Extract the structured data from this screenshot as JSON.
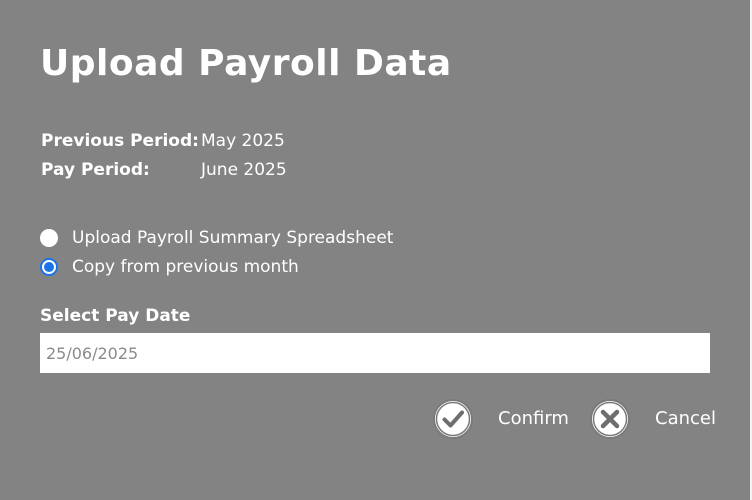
{
  "dialog": {
    "title": "Upload Payroll Data",
    "info": {
      "previous_period_label": "Previous Period:",
      "previous_period_value": "May 2025",
      "pay_period_label": "Pay Period:",
      "pay_period_value": "June 2025"
    },
    "options": [
      {
        "label": "Upload Payroll Summary Spreadsheet",
        "selected": false
      },
      {
        "label": "Copy from previous month",
        "selected": true
      }
    ],
    "pay_date": {
      "label": "Select Pay Date",
      "value": "25/06/2025"
    },
    "actions": {
      "confirm_label": "Confirm",
      "confirm_icon": "check-circle-icon",
      "cancel_label": "Cancel",
      "cancel_icon": "x-circle-icon"
    },
    "colors": {
      "background": "#838383",
      "radio_accent": "#1a73e8",
      "text": "#ffffff",
      "input_text": "#8a8a8a"
    }
  }
}
